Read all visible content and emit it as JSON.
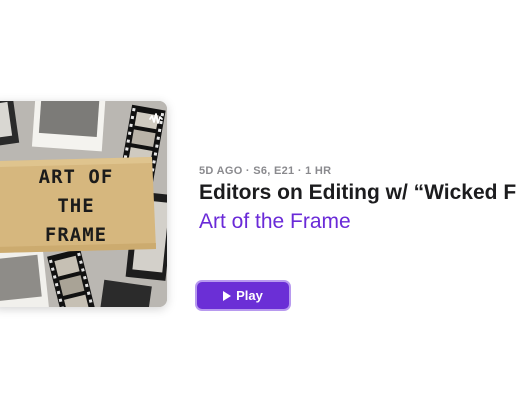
{
  "episode": {
    "meta": "5D AGO · S6, E21 · 1 HR",
    "title": "Editors on Editing w/ “Wicked F",
    "show": "Art of the Frame",
    "play_label": "Play"
  },
  "artwork": {
    "text": "ART OF\nTHE\nFRAME",
    "badge_icon": "podcast-icon"
  },
  "colors": {
    "accent": "#6b2fd6",
    "show_link": "#6a2ad8",
    "meta": "#8a8a8e",
    "title": "#1c1c1e"
  }
}
